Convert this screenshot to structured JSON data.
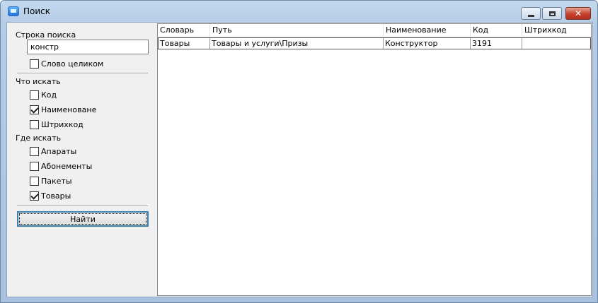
{
  "window": {
    "title": "Поиск",
    "colors": {
      "accent": "#3c7fb1",
      "close_button": "#c5412d"
    }
  },
  "search": {
    "label": "Строка поиска",
    "value": "констр",
    "whole_word_label": "Слово целиком",
    "whole_word_checked": false
  },
  "what": {
    "heading": "Что искать",
    "options": [
      {
        "label": "Код",
        "checked": false
      },
      {
        "label": "Наименоване",
        "checked": true
      },
      {
        "label": "Штрихкод",
        "checked": false
      }
    ]
  },
  "where": {
    "heading": "Где искать",
    "options": [
      {
        "label": "Апараты",
        "checked": false
      },
      {
        "label": "Абонементы",
        "checked": false
      },
      {
        "label": "Пакеты",
        "checked": false
      },
      {
        "label": "Товары",
        "checked": true
      }
    ]
  },
  "find_button": "Найти",
  "table": {
    "columns": [
      "Словарь",
      "Путь",
      "Наименование",
      "Код",
      "Штрихкод"
    ],
    "rows": [
      [
        "Товары",
        "Товары и услуги\\Призы",
        "Конструктор",
        "3191",
        ""
      ]
    ]
  }
}
